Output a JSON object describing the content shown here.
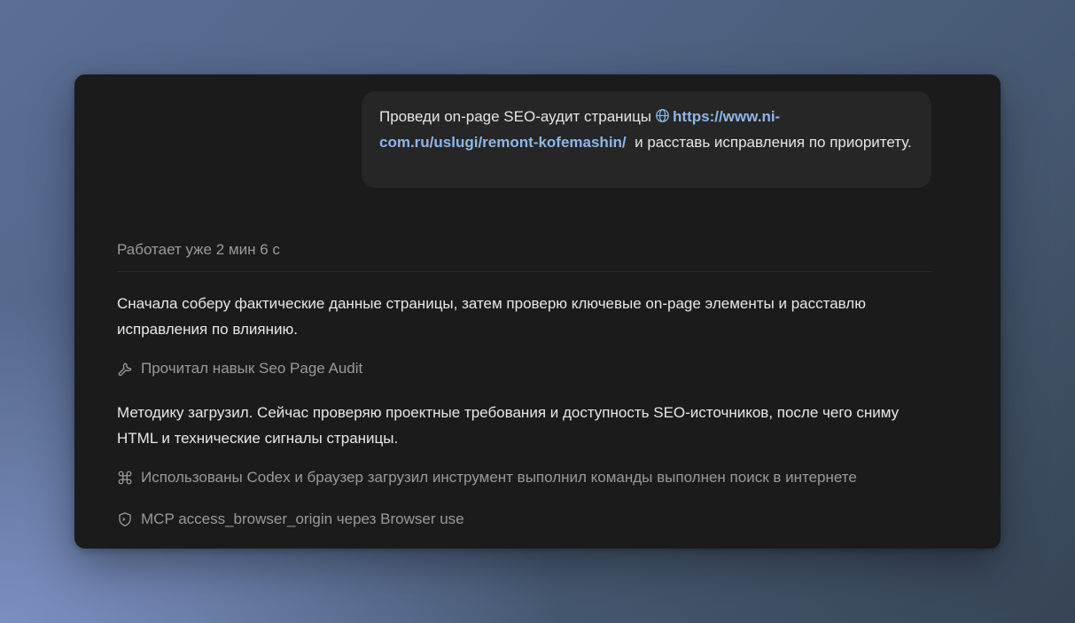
{
  "user_message": {
    "text_before": "Проведи on-page SEO-аудит страницы",
    "link_text": "https://www.ni-com.ru/uslugi/remont-kofemashin/",
    "text_after": "и расставь исправления по приоритету.",
    "globe_icon": "globe-icon"
  },
  "status": {
    "text": "Работает уже 2 мин 6 с"
  },
  "messages": [
    "Сначала соберу фактические данные страницы, затем проверю ключевые on-page элементы и расставлю исправления по влиянию.",
    "Методику загрузил. Сейчас проверяю проектные требования и доступность SEO-источников, после чего сниму HTML и технические сигналы страницы."
  ],
  "actions": [
    {
      "icon": "wrench-icon",
      "label": "Прочитал навык Seo Page Audit"
    },
    {
      "icon": "command-icon",
      "label": "Использованы Codex и браузер загрузил инструмент выполнил команды выполнен поиск в интернете"
    },
    {
      "icon": "shield-icon",
      "label": "MCP access_browser_origin через Browser use"
    }
  ],
  "colors": {
    "window_bg": "#1b1b1c",
    "bubble_bg": "#262627",
    "link": "#8fb6e8",
    "muted_text": "#9a9a9a",
    "body_text": "#e8e8e8"
  }
}
